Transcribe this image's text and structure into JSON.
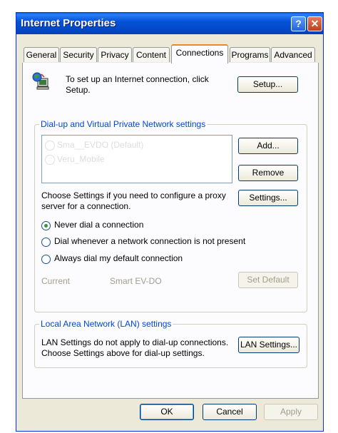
{
  "window": {
    "title": "Internet Properties",
    "help_glyph": "?",
    "close_glyph": "✕"
  },
  "tabs": [
    {
      "label": "General"
    },
    {
      "label": "Security"
    },
    {
      "label": "Privacy"
    },
    {
      "label": "Content"
    },
    {
      "label": "Connections",
      "active": true
    },
    {
      "label": "Programs"
    },
    {
      "label": "Advanced"
    }
  ],
  "setup": {
    "text_line1": "To set up an Internet connection, click",
    "text_line2": "Setup.",
    "button": "Setup..."
  },
  "dialup": {
    "group_label": "Dial-up and Virtual Private Network settings",
    "connections": [
      "Sma__EVDO (Default)",
      "Veru_Mobile"
    ],
    "add_button": "Add...",
    "remove_button": "Remove",
    "proxy_text_line1": "Choose Settings if you need to configure a proxy",
    "proxy_text_line2": "server for a connection.",
    "settings_button": "Settings...",
    "radios": [
      {
        "label": "Never dial a connection",
        "checked": true
      },
      {
        "label": "Dial whenever a network connection is not present",
        "checked": false
      },
      {
        "label": "Always dial my default connection",
        "checked": false
      }
    ],
    "current_label": "Current",
    "current_value": "Smart EV-DO",
    "set_default_button": "Set Default"
  },
  "lan": {
    "group_label": "Local Area Network (LAN) settings",
    "text_line1": "LAN Settings do not apply to dial-up connections.",
    "text_line2": "Choose Settings above for dial-up settings.",
    "button": "LAN Settings..."
  },
  "footer": {
    "ok": "OK",
    "cancel": "Cancel",
    "apply": "Apply"
  },
  "colors": {
    "title_bar": "#0553d8",
    "group_label": "#0046d5",
    "active_tab_accent": "#e68b2c",
    "dialog_bg": "#ece9d8"
  },
  "icons": [
    "globe-computer-icon",
    "dialup-connection-icon"
  ]
}
